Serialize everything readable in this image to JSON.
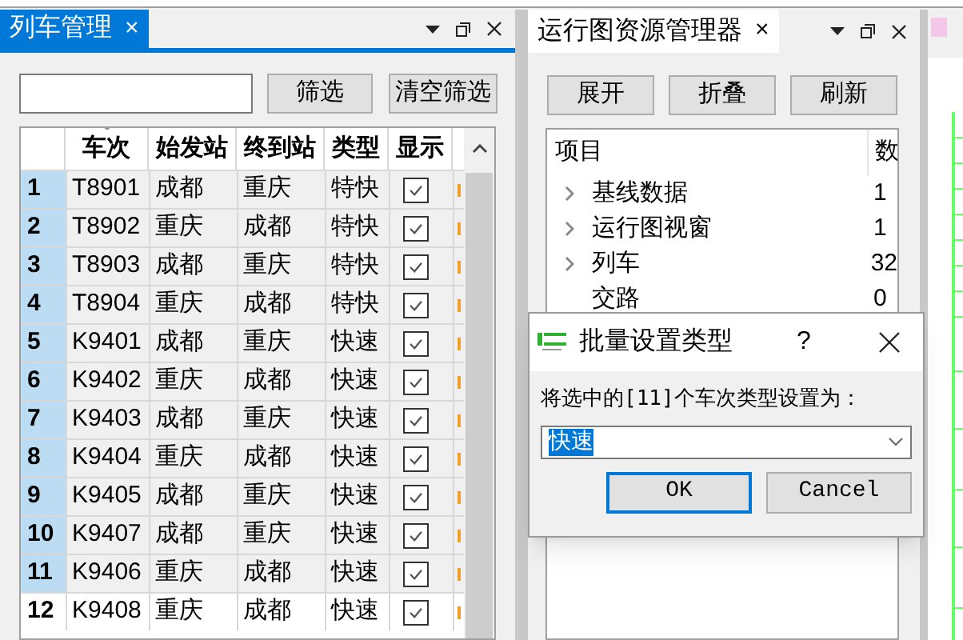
{
  "left_panel": {
    "tab": {
      "label": "列车管理",
      "close": "×",
      "selected": true
    },
    "filter": {
      "buttons": [
        "筛选",
        "清空筛选"
      ]
    },
    "table": {
      "columns": [
        "车次",
        "始发站",
        "终到站",
        "类型",
        "显示"
      ],
      "rows": [
        {
          "index": "1",
          "train": "T8901",
          "from": "成都",
          "to": "重庆",
          "type": "特快",
          "show": true,
          "selected": true
        },
        {
          "index": "2",
          "train": "T8902",
          "from": "重庆",
          "to": "成都",
          "type": "特快",
          "show": true,
          "selected": true
        },
        {
          "index": "3",
          "train": "T8903",
          "from": "成都",
          "to": "重庆",
          "type": "特快",
          "show": true,
          "selected": true
        },
        {
          "index": "4",
          "train": "T8904",
          "from": "重庆",
          "to": "成都",
          "type": "特快",
          "show": true,
          "selected": true
        },
        {
          "index": "5",
          "train": "K9401",
          "from": "成都",
          "to": "重庆",
          "type": "快速",
          "show": true,
          "selected": true
        },
        {
          "index": "6",
          "train": "K9402",
          "from": "重庆",
          "to": "成都",
          "type": "快速",
          "show": true,
          "selected": true
        },
        {
          "index": "7",
          "train": "K9403",
          "from": "成都",
          "to": "重庆",
          "type": "快速",
          "show": true,
          "selected": true
        },
        {
          "index": "8",
          "train": "K9404",
          "from": "重庆",
          "to": "成都",
          "type": "快速",
          "show": true,
          "selected": true
        },
        {
          "index": "9",
          "train": "K9405",
          "from": "成都",
          "to": "重庆",
          "type": "快速",
          "show": true,
          "selected": true
        },
        {
          "index": "10",
          "train": "K9407",
          "from": "成都",
          "to": "重庆",
          "type": "快速",
          "show": true,
          "selected": true
        },
        {
          "index": "11",
          "train": "K9406",
          "from": "重庆",
          "to": "成都",
          "type": "快速",
          "show": true,
          "selected": true
        },
        {
          "index": "12",
          "train": "K9408",
          "from": "重庆",
          "to": "成都",
          "type": "快速",
          "show": true,
          "selected": false
        }
      ]
    }
  },
  "right_panel": {
    "tab": {
      "label": "运行图资源管理器",
      "close": "×",
      "selected": true
    },
    "buttons": [
      "展开",
      "折叠",
      "刷新"
    ],
    "tree": {
      "columns": [
        "项目",
        "数"
      ],
      "items": [
        {
          "label": "基线数据",
          "count": "1",
          "expandable": true
        },
        {
          "label": "运行图视窗",
          "count": "1",
          "expandable": true
        },
        {
          "label": "列车",
          "count": "32",
          "expandable": true
        },
        {
          "label": "交路",
          "count": "0",
          "expandable": false
        }
      ]
    }
  },
  "dialog": {
    "title": "批量设置类型",
    "help": "?",
    "prompt": "将选中的[11]个车次类型设置为：",
    "value": "快速",
    "buttons": [
      {
        "label": "OK",
        "default": true
      },
      {
        "label": "Cancel",
        "default": false
      }
    ]
  }
}
